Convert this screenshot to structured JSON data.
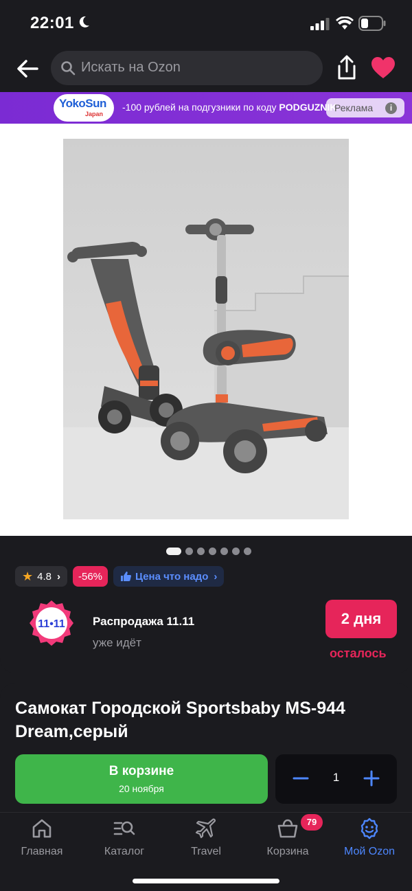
{
  "status_bar": {
    "time": "22:01"
  },
  "search": {
    "placeholder": "Искать на Ozon"
  },
  "ad_banner": {
    "brand_line1": "YokoSun",
    "brand_line2": "Japan",
    "text_prefix": "-100 рублей на подгузники по коду ",
    "promo_code": "PODGUZNIK",
    "tag_label": "Реклама",
    "info_glyph": "i"
  },
  "gallery": {
    "photo_count": 7,
    "active_index": 0
  },
  "chips": {
    "rating": "4.8",
    "discount": "-56%",
    "price_label": "Цена что надо"
  },
  "sale": {
    "badge_text": "11•11",
    "title": "Распродажа 11.11",
    "subtitle": "уже идёт",
    "days": "2 дня",
    "days_caption": "осталось"
  },
  "product": {
    "title": "Самокат Городской Sportsbaby MS-944 Dream,серый",
    "cart_label": "В корзине",
    "delivery_date": "20 ноября",
    "quantity": "1"
  },
  "tabbar": {
    "items": [
      {
        "label": "Главная",
        "icon": "home-icon"
      },
      {
        "label": "Каталог",
        "icon": "catalog-search-icon"
      },
      {
        "label": "Travel",
        "icon": "airplane-icon"
      },
      {
        "label": "Корзина",
        "icon": "basket-icon",
        "badge": "79"
      },
      {
        "label": "Мой Ozon",
        "icon": "profile-smile-icon",
        "active": true
      }
    ]
  },
  "colors": {
    "background": "#1b1b1f",
    "accent_blue": "#4d87ff",
    "sale_pink": "#e6255a",
    "cart_green": "#3fb54a",
    "ad_purple": "#7b2bd3"
  }
}
